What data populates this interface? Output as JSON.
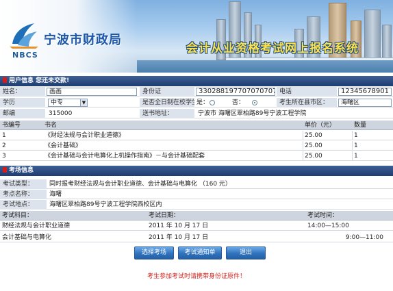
{
  "header": {
    "logo_text": "NBCS",
    "agency_name": "宁波市财政局",
    "system_title": "会计从业资格考试网上报名系统"
  },
  "user_section": {
    "title": "用户信息  您还未交款!"
  },
  "user": {
    "name_label": "姓名：",
    "name_value": "画画",
    "id_label": "身份证",
    "id_value": "330288197707070707",
    "phone_label": "电话",
    "phone_value": "12345678901",
    "education_label": "学历",
    "education_value": "中专",
    "fulltime_label": "是否全日制在校学生：",
    "fulltime_yes": "是：",
    "fulltime_no": "否：",
    "fulltime_selected": "no",
    "district_label": "考生所在县市区：",
    "district_value": "海曙区",
    "postcode_label": "邮编",
    "postcode_value": "315000",
    "address_label": "送书地址：",
    "address_value": "宁波市 海曙区翠柏路89号宁波工程学院"
  },
  "books": {
    "headers": [
      "书编号",
      "书名",
      "单价（元）",
      "数量"
    ],
    "rows": [
      [
        "1",
        "《财经法规与会计职业道德》",
        "25.00",
        "1"
      ],
      [
        "2",
        "《会计基础》",
        "25.00",
        "1"
      ],
      [
        "3",
        "《会计基础与会计电算化上机操作指南》－与会计基础配套",
        "25.00",
        "1"
      ]
    ]
  },
  "exam_section": {
    "title": "考场信息"
  },
  "exam": {
    "type_label": "考试类型：",
    "type_value": "同时报考财经法规与会计职业道德、会计基础与电算化 （160 元）",
    "site_label": "考点名称：",
    "site_value": "海曙",
    "location_label": "考试地点：",
    "location_value": "海曙区翠柏路89号宁波工程学院西校区内",
    "headers": [
      "考试科目：",
      "考试日期：",
      "考试时间："
    ],
    "rows": [
      [
        "财经法规与会计职业道德",
        "2011 年 10 月 17 日",
        "14:00—15:00"
      ],
      [
        "会计基础与电算化",
        "2011 年 10 月 17 日",
        "9:00—11:00"
      ]
    ]
  },
  "buttons": {
    "choose_site": "选择考场",
    "exam_notice": "考试通知单",
    "exit": "退出"
  },
  "notice": "考生参加考试时请携带身份证原件！",
  "colors": {
    "section_bar": "#1e3c70",
    "section_marker": "#d21d1d",
    "button": "#2f72bd",
    "notice": "#d9231c",
    "title_yellow": "#ffe24a"
  }
}
